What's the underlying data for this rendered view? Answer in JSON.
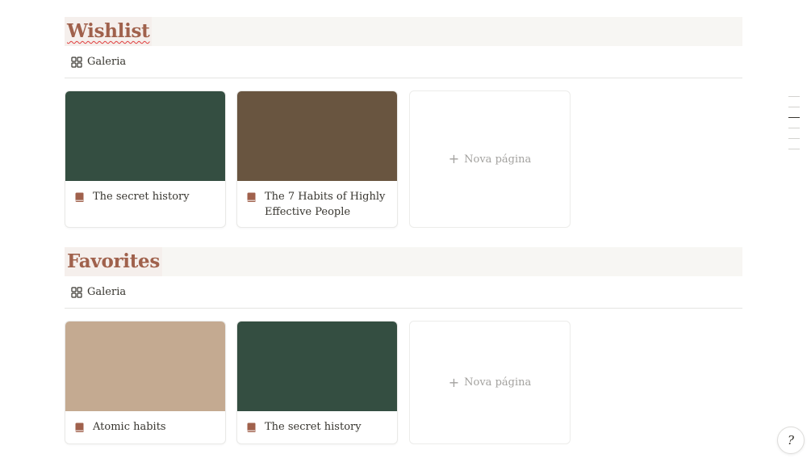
{
  "sections": [
    {
      "title": "Wishlist",
      "view_label": "Galeria",
      "cards": [
        {
          "title": "The secret history",
          "cover_color": "#344e41"
        },
        {
          "title": "The 7 Habits of Highly Effective People",
          "cover_color": "#695540"
        }
      ],
      "new_page_label": "Nova página"
    },
    {
      "title": "Favorites",
      "view_label": "Galeria",
      "cards": [
        {
          "title": "Atomic habits",
          "cover_color": "#c4aa91"
        },
        {
          "title": "The secret history",
          "cover_color": "#344e41"
        }
      ],
      "new_page_label": "Nova página"
    }
  ],
  "colors": {
    "title_accent": "#a0614c",
    "book_icon": "#a0614c"
  },
  "help_icon": "question-icon"
}
